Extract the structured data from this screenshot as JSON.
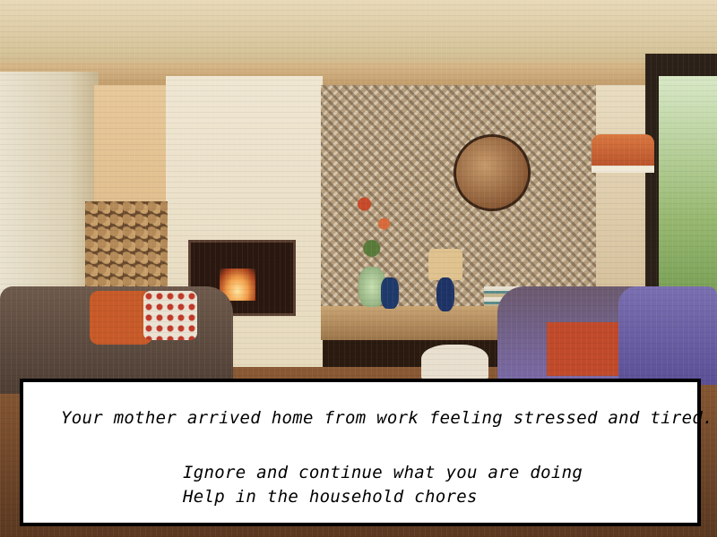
{
  "scene": {
    "background": "pixel-art living room with fireplace, patterned wall, round mirror, sofas and window"
  },
  "dialog": {
    "narration": "Your mother arrived home from work feeling stressed and tired.",
    "choices": [
      {
        "label": "Ignore and continue what you are doing"
      },
      {
        "label": "Help in the household chores"
      }
    ]
  },
  "colors": {
    "dialog_bg": "#ffffff",
    "dialog_border": "#000000",
    "text": "#000000"
  }
}
